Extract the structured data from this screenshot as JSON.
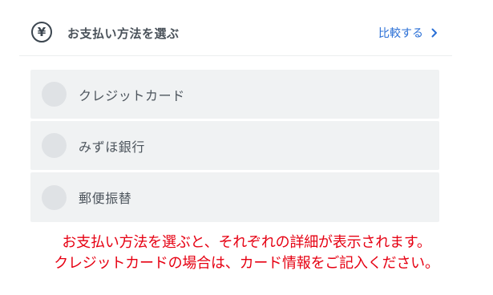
{
  "header": {
    "icon": "yen-icon",
    "title": "お支払い方法を選ぶ",
    "compare_label": "比較する"
  },
  "payment_options": [
    {
      "label": "クレジットカード",
      "selected": false
    },
    {
      "label": "みずほ銀行",
      "selected": false
    },
    {
      "label": "郵便振替",
      "selected": false
    }
  ],
  "notes": {
    "line1": "お支払い方法を選ぶと、それぞれの詳細が表示されます。",
    "line2": "クレジットカードの場合は、カード情報をご記入ください。"
  },
  "colors": {
    "accent": "#2a6fd6",
    "note": "#e60012",
    "option_bg": "#f0f2f3",
    "radio": "#dfe2e5"
  }
}
